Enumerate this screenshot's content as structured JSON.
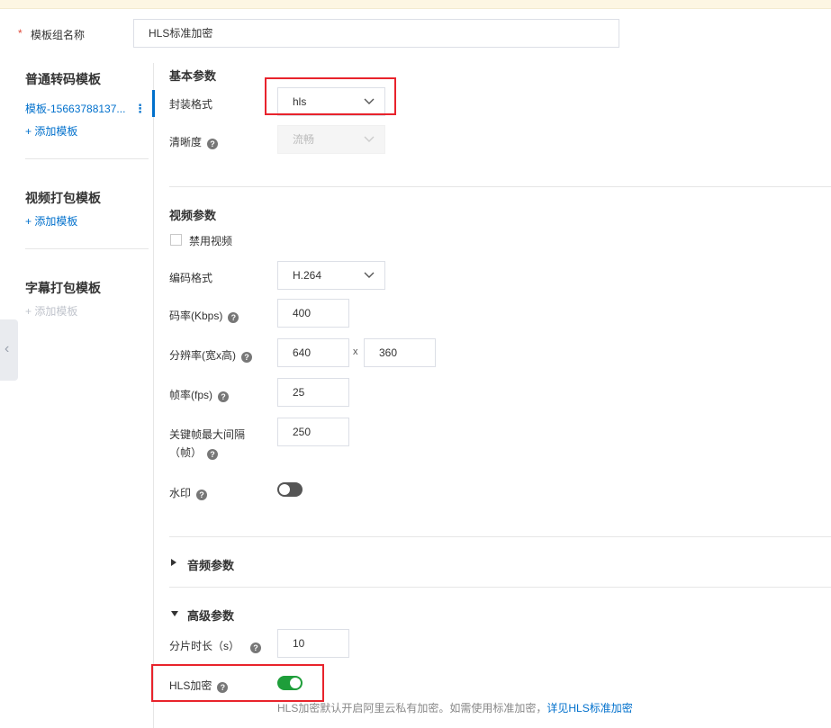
{
  "top": {
    "required_mark": "*",
    "name_label": "模板组名称",
    "name_value": "HLS标准加密"
  },
  "sidebar": {
    "sections": [
      {
        "title": "普通转码模板",
        "items": [
          "模板-15663788137..."
        ],
        "add_label": "+ 添加模板"
      },
      {
        "title": "视频打包模板",
        "items": [],
        "add_label": "+ 添加模板"
      },
      {
        "title": "字幕打包模板",
        "items": [],
        "add_label": "+ 添加模板"
      }
    ]
  },
  "basic": {
    "title": "基本参数",
    "container_label": "封装格式",
    "container_value": "hls",
    "quality_label": "清晰度",
    "quality_value": "流畅"
  },
  "video": {
    "title": "视频参数",
    "disable_label": "禁用视频",
    "codec_label": "编码格式",
    "codec_value": "H.264",
    "bitrate_label": "码率(Kbps)",
    "bitrate_value": "400",
    "resolution_label": "分辨率(宽x高)",
    "width_value": "640",
    "times": "x",
    "height_value": "360",
    "fps_label": "帧率(fps)",
    "fps_value": "25",
    "gop_label_line1": "关键帧最大间隔",
    "gop_label_line2": "（帧）",
    "gop_value": "250",
    "watermark_label": "水印",
    "watermark_on": false
  },
  "audio": {
    "title": "音频参数"
  },
  "advanced": {
    "title": "高级参数",
    "segment_label": "分片时长（s）",
    "segment_value": "10",
    "hls_encrypt_label": "HLS加密",
    "hls_encrypt_on": true,
    "hint_text": "HLS加密默认开启阿里云私有加密。如需使用标准加密，",
    "hint_link": "详见HLS标准加密"
  },
  "colors": {
    "link": "#0070cc",
    "toggle_on": "#1e9e3a",
    "highlight": "#e8232c"
  }
}
